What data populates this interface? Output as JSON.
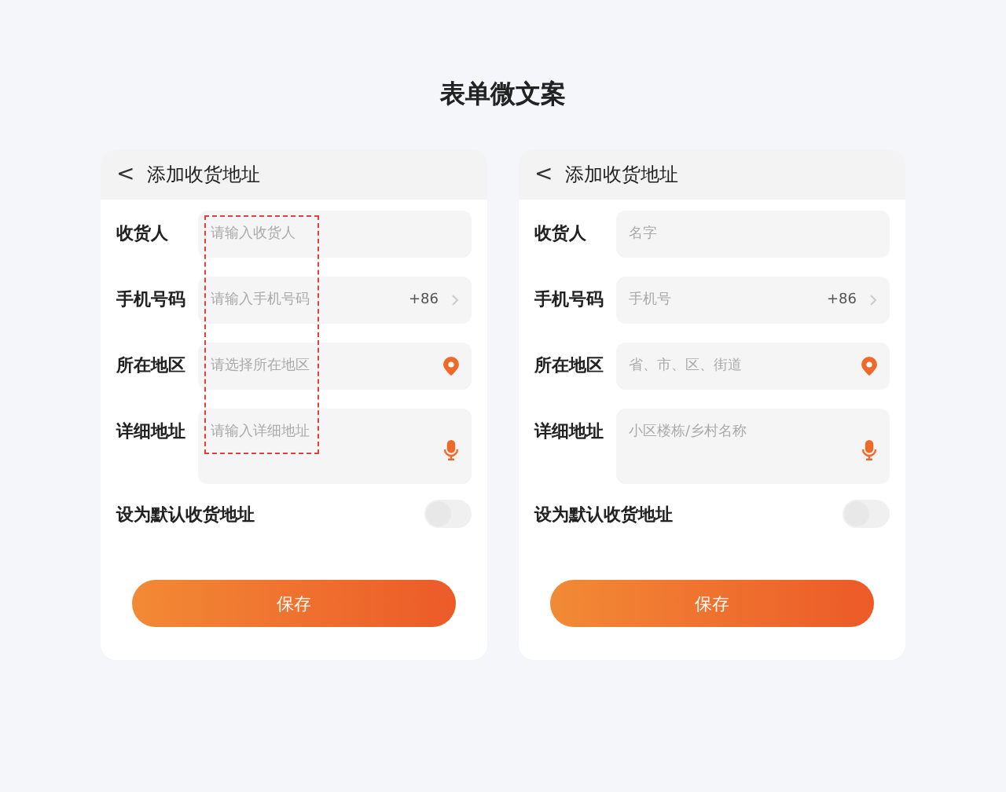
{
  "title": "表单微文案",
  "cards": [
    {
      "header": {
        "back": "<",
        "title": "添加收货地址"
      },
      "annotated": true,
      "fields": [
        {
          "kind": "text",
          "label": "收货人",
          "placeholder": "请输入收货人"
        },
        {
          "kind": "phone",
          "label": "手机号码",
          "placeholder": "请输入手机号码",
          "code": "+86"
        },
        {
          "kind": "region",
          "label": "所在地区",
          "placeholder": "请选择所在地区"
        },
        {
          "kind": "detail",
          "label": "详细地址",
          "placeholder": "请输入详细地址"
        }
      ],
      "default_toggle": {
        "label": "设为默认收货地址",
        "on": false
      },
      "save_button": "保存"
    },
    {
      "header": {
        "back": "<",
        "title": "添加收货地址"
      },
      "annotated": false,
      "fields": [
        {
          "kind": "text",
          "label": "收货人",
          "placeholder": "名字"
        },
        {
          "kind": "phone",
          "label": "手机号码",
          "placeholder": "手机号",
          "code": "+86"
        },
        {
          "kind": "region",
          "label": "所在地区",
          "placeholder": "省、市、区、街道"
        },
        {
          "kind": "detail",
          "label": "详细地址",
          "placeholder": "小区楼栋/乡村名称"
        }
      ],
      "default_toggle": {
        "label": "设为默认收货地址",
        "on": false
      },
      "save_button": "保存"
    }
  ]
}
